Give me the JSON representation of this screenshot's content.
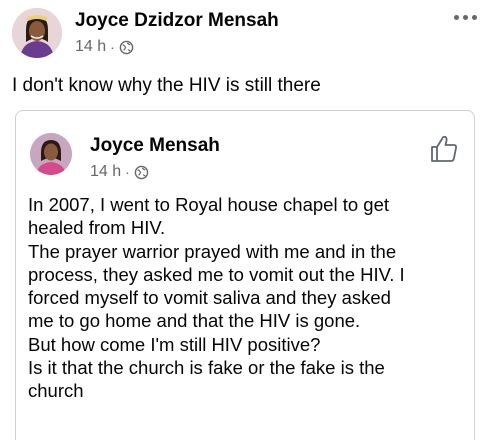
{
  "post": {
    "author": "Joyce Dzidzor Mensah",
    "time": "14 h",
    "separator": "·",
    "audience_icon": "globe-icon",
    "menu_icon": "more-options-icon",
    "text": "I don't know why the HIV is still there"
  },
  "shared_post": {
    "author": "Joyce Mensah",
    "time": "14 h",
    "separator": "·",
    "audience_icon": "globe-icon",
    "action_icon": "like-icon",
    "lines": [
      "In 2007, I went to Royal house chapel to get",
      "healed from HIV.",
      "The prayer warrior prayed with me and in the",
      "process, they asked me to vomit out the HIV. I",
      "forced myself to vomit saliva and they asked",
      "me to go home and that the HIV is gone.",
      "But how come I'm still HIV positive?",
      "Is it that the church is fake or the fake is the",
      "church"
    ]
  },
  "colors": {
    "text_primary": "#050505",
    "text_secondary": "#65676b",
    "border": "#ced0d4",
    "background": "#ffffff"
  }
}
